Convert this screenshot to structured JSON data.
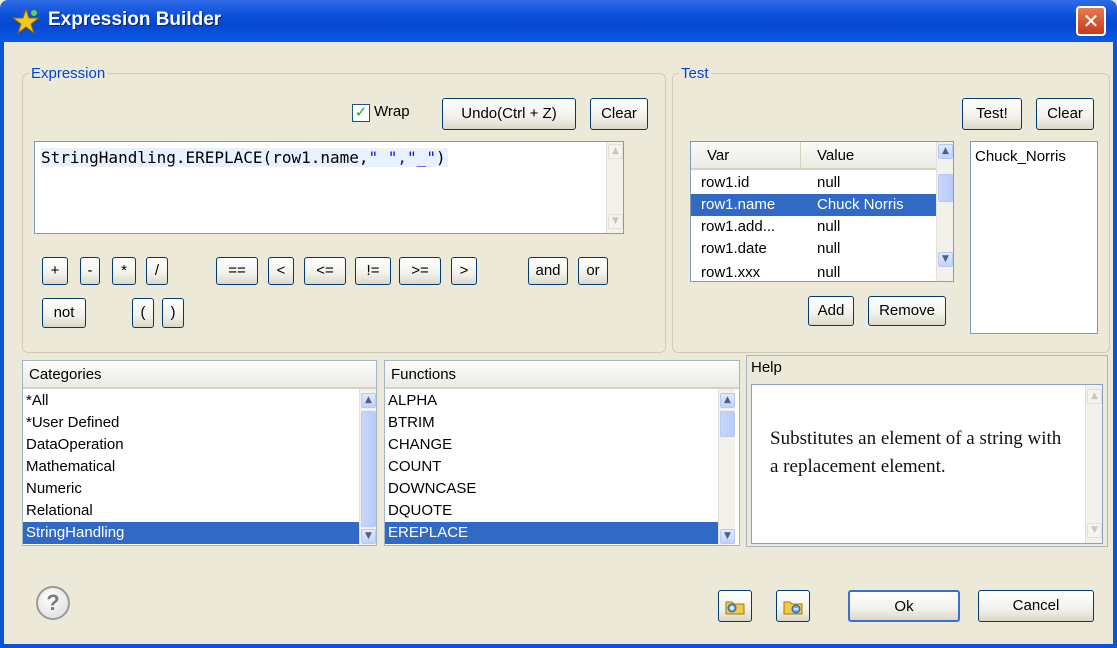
{
  "window": {
    "title": "Expression Builder",
    "close_glyph": "✕"
  },
  "expression": {
    "legend": "Expression",
    "wrap_label": "Wrap",
    "wrap_checked": true,
    "undo_label": "Undo(Ctrl + Z)",
    "clear_label": "Clear",
    "text_prefix": "StringHandling.EREPLACE(row1.name,",
    "text_args": "\" \",\"_\"",
    "text_suffix": ")",
    "operators_row1": [
      "+",
      "-",
      "*",
      "/",
      "==",
      "<",
      "<=",
      "!=",
      ">=",
      ">",
      "and",
      "or"
    ],
    "operators_row2": [
      "not",
      "(",
      ")"
    ]
  },
  "test": {
    "legend": "Test",
    "test_button": "Test!",
    "clear_button": "Clear",
    "columns": [
      "Var",
      "Value"
    ],
    "rows": [
      {
        "var": "row1.id",
        "value": "null"
      },
      {
        "var": "row1.name",
        "value": "Chuck Norris"
      },
      {
        "var": "row1.add...",
        "value": "null"
      },
      {
        "var": "row1.date",
        "value": "null"
      },
      {
        "var": "row1.xxx",
        "value": "null"
      }
    ],
    "selected_row": 1,
    "add_button": "Add",
    "remove_button": "Remove",
    "result": "Chuck_Norris"
  },
  "categories": {
    "header": "Categories",
    "items": [
      "*All",
      "*User Defined",
      "DataOperation",
      "Mathematical",
      "Numeric",
      "Relational",
      "StringHandling",
      "..."
    ],
    "selected": 6
  },
  "functions": {
    "header": "Functions",
    "items": [
      "ALPHA",
      "BTRIM",
      "CHANGE",
      "COUNT",
      "DOWNCASE",
      "DQUOTE",
      "EREPLACE"
    ],
    "selected": 6
  },
  "help": {
    "header": "Help",
    "text": "Substitutes an element of a string with a replacement element."
  },
  "footer": {
    "help_icon": "?",
    "ok_label": "Ok",
    "cancel_label": "Cancel"
  },
  "colors": {
    "selection": "#316ac5",
    "legend": "#0046d5",
    "string_literal": "#2a00ff"
  }
}
